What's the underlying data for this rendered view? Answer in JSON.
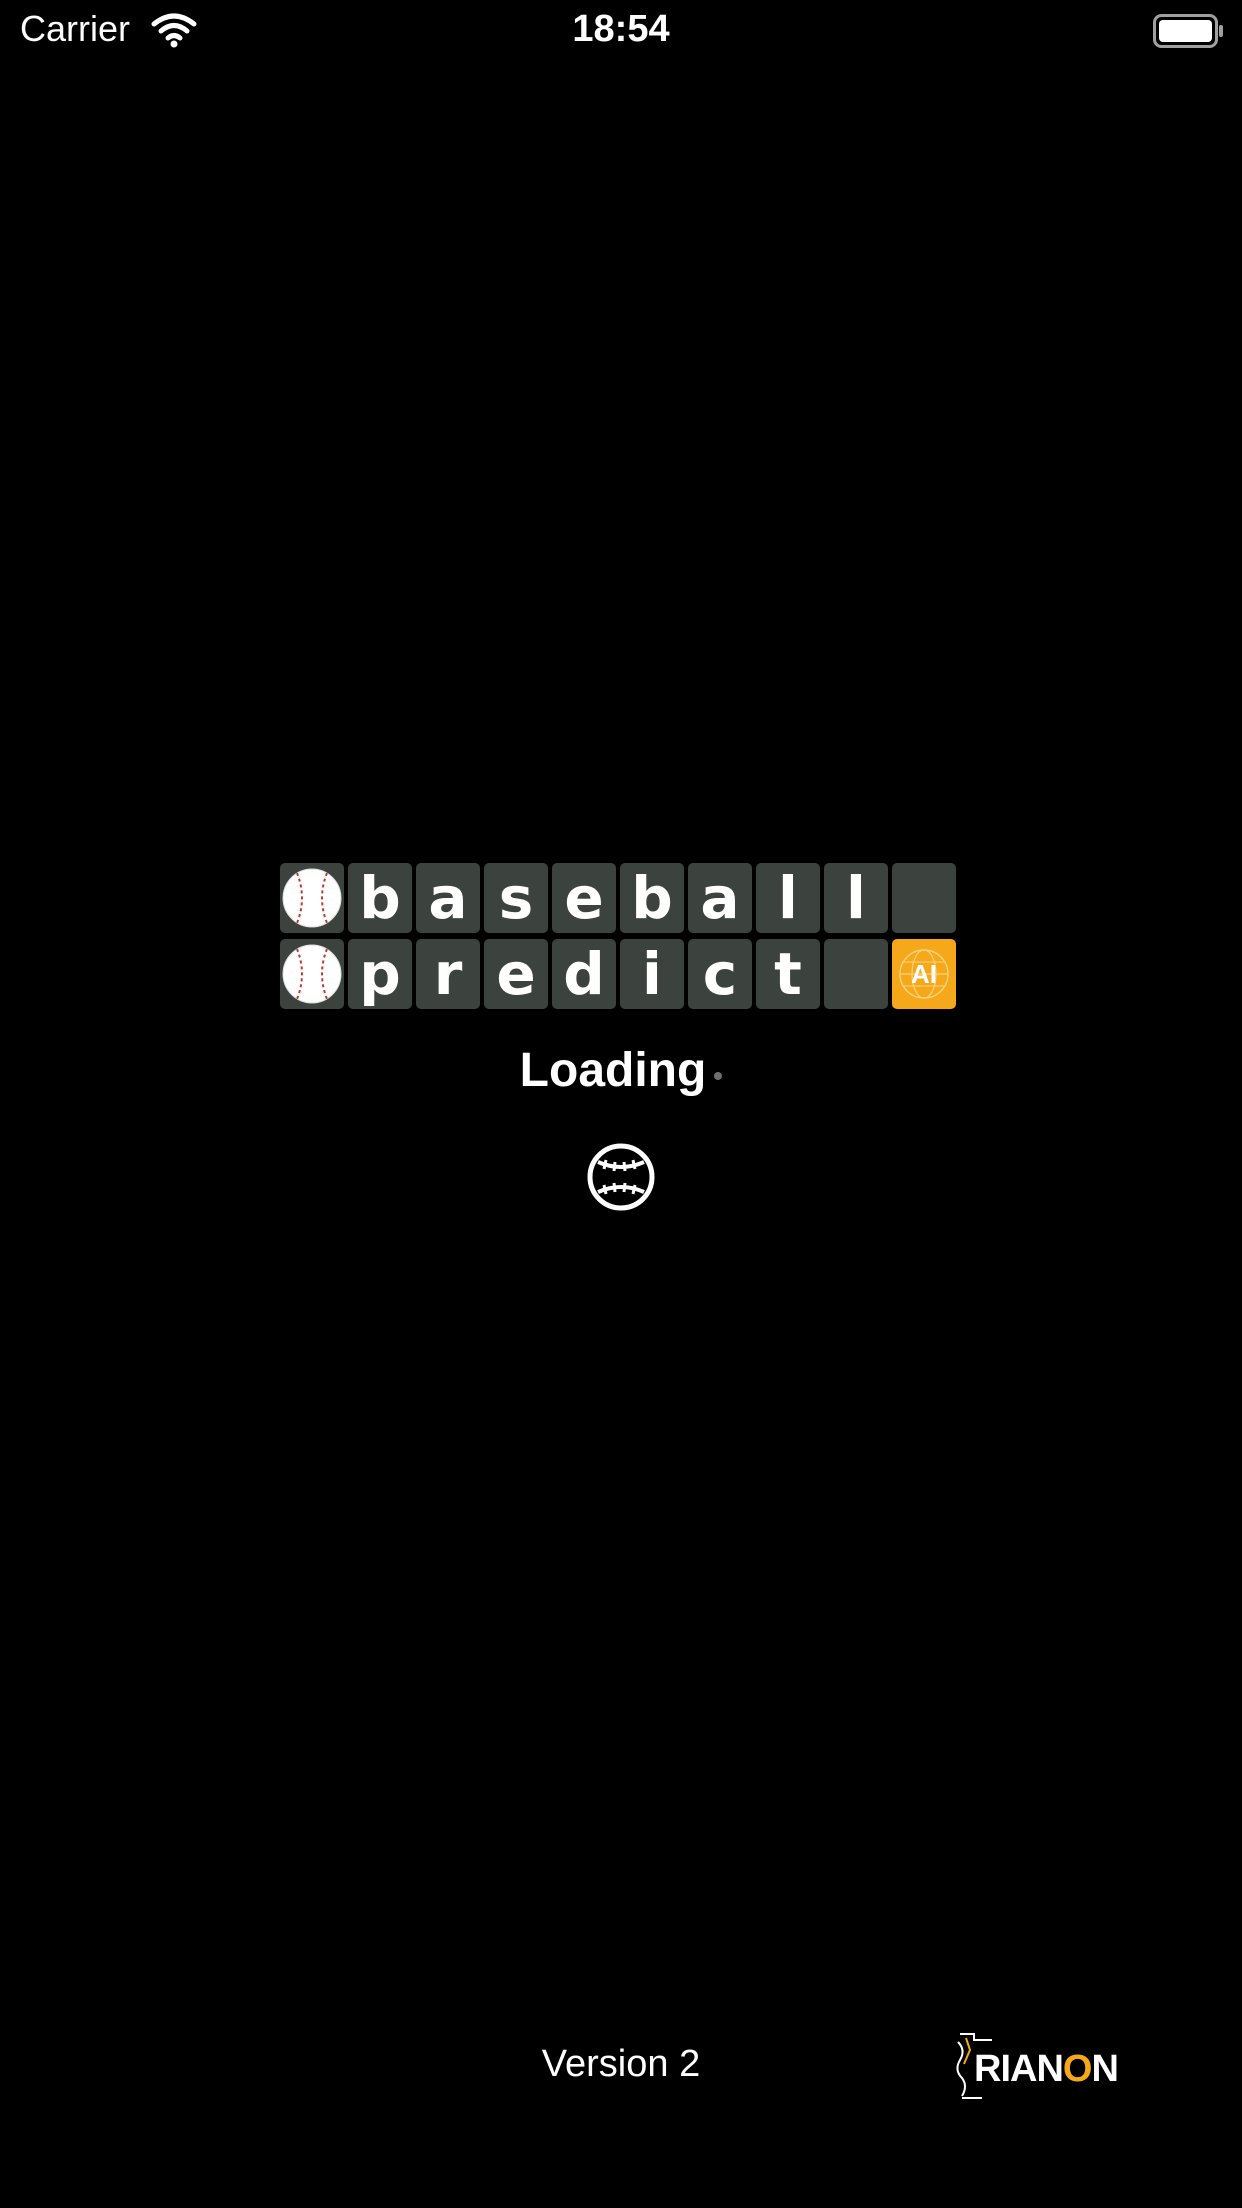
{
  "status_bar": {
    "carrier": "Carrier",
    "time": "18:54"
  },
  "logo": {
    "row1": [
      "",
      "b",
      "a",
      "s",
      "e",
      "b",
      "a",
      "l",
      "l",
      ""
    ],
    "row2": [
      "",
      "p",
      "r",
      "e",
      "d",
      "i",
      "c",
      "t",
      "",
      ""
    ],
    "ai_badge": "AI",
    "colors": {
      "tile": "#3c423d",
      "accent": "#f6a81b"
    }
  },
  "loading": {
    "text": "Loading"
  },
  "footer": {
    "version": "Version 2",
    "brand": {
      "prefix": "RIAN",
      "highlight": "O",
      "suffix": "N"
    }
  }
}
